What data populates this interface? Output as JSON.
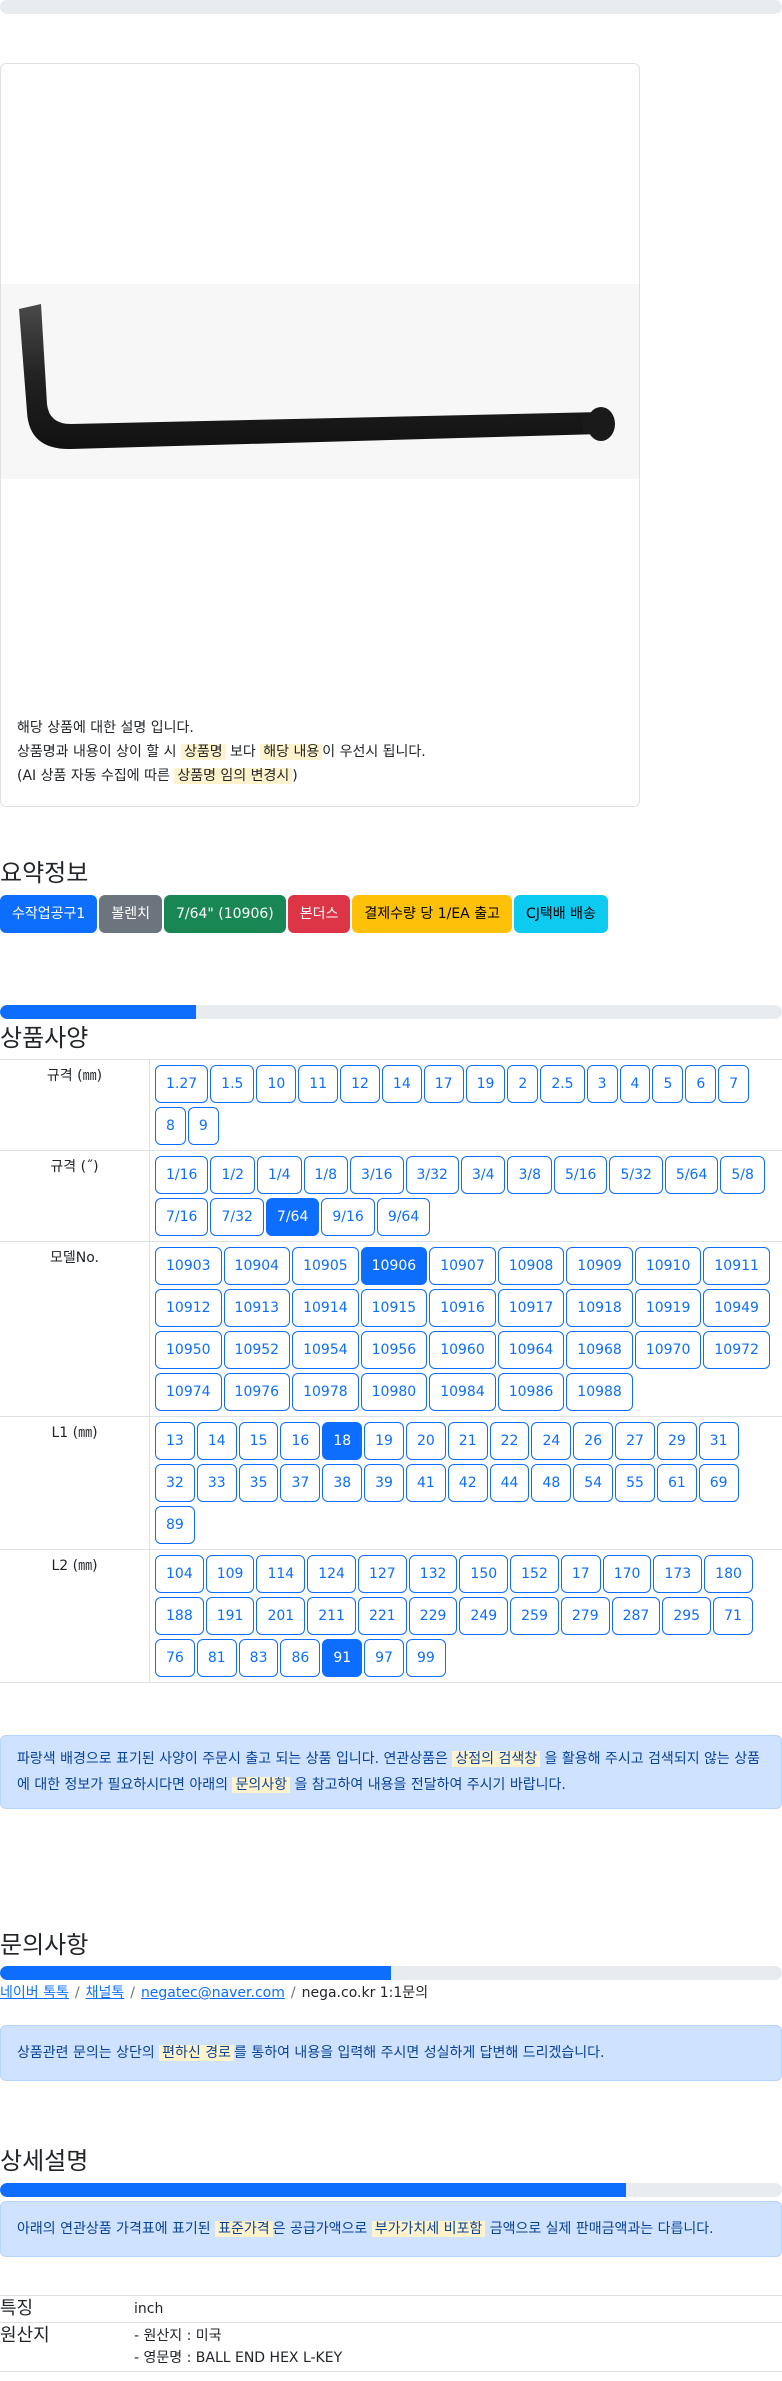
{
  "image_card": {
    "desc_line1": "해당 상품에 대한 설명 입니다.",
    "desc_line2_a": "상품명과 내용이 상이 할 시",
    "desc_line2_hl1": "상품명",
    "desc_line2_b": "보다",
    "desc_line2_hl2": "해당 내용",
    "desc_line2_c": "이 우선시 됩니다.",
    "desc_line3_a": "(AI 상품 자동 수집에 따른",
    "desc_line3_hl": "상품명 임의 변경시",
    "desc_line3_b": ")"
  },
  "summary": {
    "title": "요약정보",
    "badges": [
      {
        "label": "수작업공구1",
        "color": "#0d6efd"
      },
      {
        "label": "볼렌치",
        "color": "#6c757d"
      },
      {
        "label": "7/64\" (10906)",
        "color": "#198754"
      },
      {
        "label": "본더스",
        "color": "#dc3545"
      },
      {
        "label": "결제수량 당 1/EA 출고",
        "color": "#ffc107",
        "text_color": "#000000"
      },
      {
        "label": "CJ택배 배송",
        "color": "#0dcaf0",
        "text_color": "#000000"
      }
    ]
  },
  "spec": {
    "progress": 0.25,
    "title": "상품사양",
    "rows": [
      {
        "label": "규격 (㎜)",
        "options": [
          "1.27",
          "1.5",
          "10",
          "11",
          "12",
          "14",
          "17",
          "19",
          "2",
          "2.5",
          "3",
          "4",
          "5",
          "6",
          "7",
          "8",
          "9"
        ],
        "selected": -1
      },
      {
        "label": "규격 (˝)",
        "options": [
          "1/16",
          "1/2",
          "1/4",
          "1/8",
          "3/16",
          "3/32",
          "3/4",
          "3/8",
          "5/16",
          "5/32",
          "5/64",
          "5/8",
          "7/16",
          "7/32",
          "7/64",
          "9/16",
          "9/64"
        ],
        "selected": 14
      },
      {
        "label": "모델No.",
        "options": [
          "10903",
          "10904",
          "10905",
          "10906",
          "10907",
          "10908",
          "10909",
          "10910",
          "10911",
          "10912",
          "10913",
          "10914",
          "10915",
          "10916",
          "10917",
          "10918",
          "10919",
          "10949",
          "10950",
          "10952",
          "10954",
          "10956",
          "10960",
          "10964",
          "10968",
          "10970",
          "10972",
          "10974",
          "10976",
          "10978",
          "10980",
          "10984",
          "10986",
          "10988"
        ],
        "selected": 3
      },
      {
        "label": "L1 (㎜)",
        "options": [
          "13",
          "14",
          "15",
          "16",
          "18",
          "19",
          "20",
          "21",
          "22",
          "24",
          "26",
          "27",
          "29",
          "31",
          "32",
          "33",
          "35",
          "37",
          "38",
          "39",
          "41",
          "42",
          "44",
          "48",
          "54",
          "55",
          "61",
          "69",
          "89"
        ],
        "selected": 4
      },
      {
        "label": "L2 (㎜)",
        "options": [
          "104",
          "109",
          "114",
          "124",
          "127",
          "132",
          "150",
          "152",
          "17",
          "170",
          "173",
          "180",
          "188",
          "191",
          "201",
          "211",
          "221",
          "229",
          "249",
          "259",
          "279",
          "287",
          "295",
          "71",
          "76",
          "81",
          "83",
          "86",
          "91",
          "97",
          "99"
        ],
        "selected": 28
      }
    ],
    "notice_a": "파랑색 배경으로 표기된 사양이 주문시 출고 되는 상품 입니다. 연관상품은",
    "notice_hl1": "상점의 검색창",
    "notice_b": "을 활용해 주시고 검색되지 않는 상품에 대한 정보가 필요하시다면 아래의",
    "notice_hl2": "문의사항",
    "notice_c": "을 참고하여 내용을 전달하여 주시기 바랍니다."
  },
  "inquiry": {
    "title": "문의사항",
    "progress": 0.5,
    "links": [
      "네이버 톡톡",
      "채널톡",
      "negatec@naver.com"
    ],
    "last": "nega.co.kr 1:1문의",
    "notice_a": "상품관련 문의는 상단의",
    "notice_hl": "편하신 경로",
    "notice_b": "를 통하여 내용을 입력해 주시면 성실하게 답변해 드리겠습니다."
  },
  "detail": {
    "title": "상세설명",
    "progress": 0.8,
    "notice_a": "아래의 연관상품 가격표에 표기된",
    "notice_hl1": "표준가격",
    "notice_b": "은 공급가액으로",
    "notice_hl2": "부가가치세 비포함",
    "notice_c": "금액으로 실제 판매금액과는 다릅니다.",
    "rows": [
      {
        "label": "특징",
        "values": [
          "inch"
        ]
      },
      {
        "label": "원산지",
        "values": [
          "- 원산지 : 미국",
          "- 영문명 : BALL END HEX L-KEY"
        ]
      }
    ]
  }
}
